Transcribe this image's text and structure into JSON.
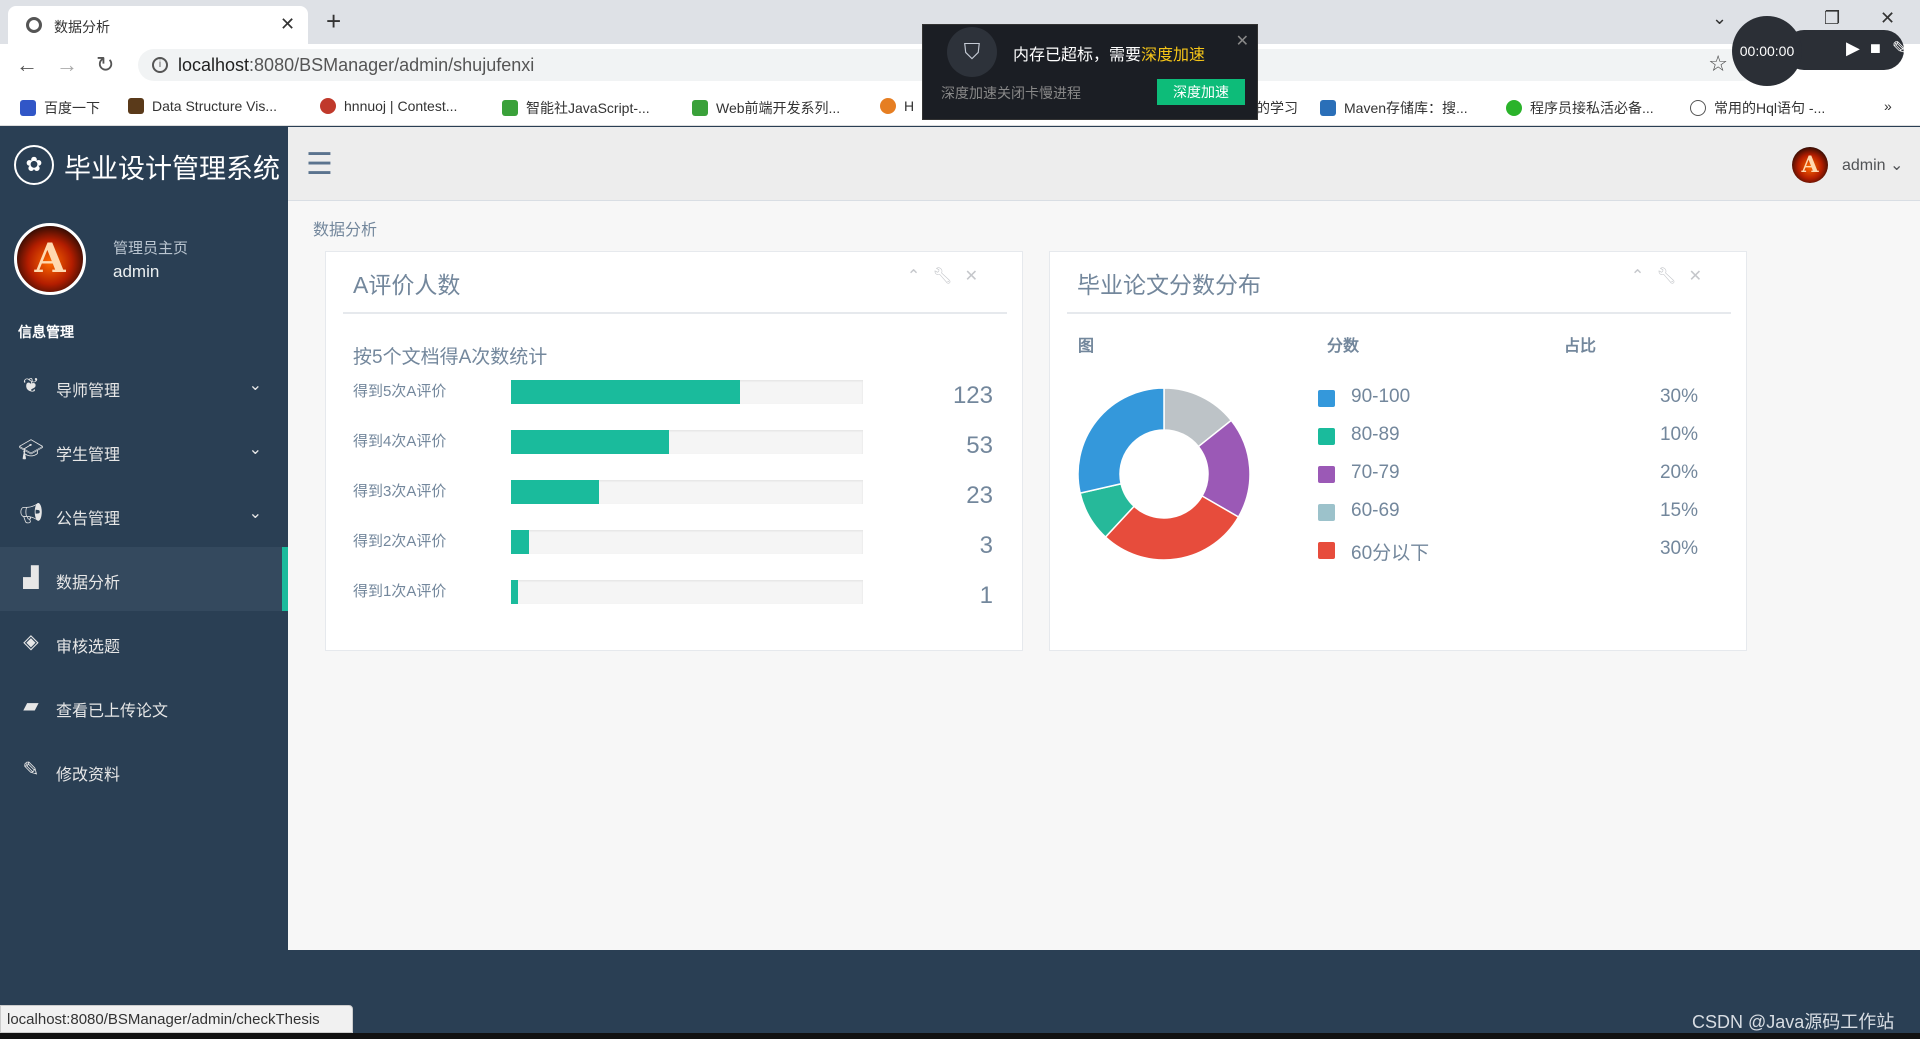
{
  "browser": {
    "tab_title": "数据分析",
    "url_host": "localhost",
    "url_rest": ":8080/BSManager/admin/shujufenxi",
    "bookmarks": [
      "百度一下",
      "Data Structure Vis...",
      "hnnuoj | Contest...",
      "智能社JavaScript-...",
      "Web前端开发系列...",
      "H",
      "的学习",
      "Maven存储库：搜...",
      "程序员接私活必备...",
      "常用的Hql语句 -..."
    ],
    "more": "»",
    "status_url": "localhost:8080/BSManager/admin/checkThesis"
  },
  "popup": {
    "line1_a": "内存已超标，需要",
    "line1_b": "深度加速",
    "line2": "深度加速关闭卡慢进程",
    "button": "深度加速"
  },
  "recorder": {
    "time": "00:00:00"
  },
  "sidebar": {
    "brand": "毕业设计管理系统",
    "welcome": "管理员主页",
    "username": "admin",
    "avatar_letter": "A",
    "section": "信息管理",
    "items": [
      {
        "label": "导师管理",
        "icon": "leaf-icon",
        "chevron": true
      },
      {
        "label": "学生管理",
        "icon": "graduation-cap-icon",
        "chevron": true
      },
      {
        "label": "公告管理",
        "icon": "bullhorn-icon",
        "chevron": true
      },
      {
        "label": "数据分析",
        "icon": "bar-chart-icon",
        "chevron": false,
        "active": true
      },
      {
        "label": "审核选题",
        "icon": "tags-icon",
        "chevron": false
      },
      {
        "label": "查看已上传论文",
        "icon": "folder-open-icon",
        "chevron": false
      },
      {
        "label": "修改资料",
        "icon": "edit-icon",
        "chevron": false
      }
    ]
  },
  "topnav": {
    "user": "admin"
  },
  "breadcrumb": "数据分析",
  "panels": {
    "left": {
      "title": "A评价人数"
    },
    "right": {
      "title": "毕业论文分数分布"
    }
  },
  "watermark": "CSDN @Java源码工作站",
  "chart_data": [
    {
      "type": "bar",
      "title": "按5个文档得A次数统计",
      "categories": [
        "得到5次A评价",
        "得到4次A评价",
        "得到3次A评价",
        "得到2次A评价",
        "得到1次A评价"
      ],
      "values": [
        123,
        53,
        23,
        3,
        1
      ],
      "fill_percent": [
        65,
        45,
        25,
        5,
        2
      ],
      "color": "#1abb9c"
    },
    {
      "type": "pie",
      "headers": [
        "图",
        "分数",
        "占比"
      ],
      "categories": [
        "90-100",
        "80-89",
        "70-79",
        "60-69",
        "60分以下"
      ],
      "values": [
        30,
        10,
        20,
        15,
        30
      ],
      "value_labels": [
        "30%",
        "10%",
        "20%",
        "15%",
        "30%"
      ],
      "legend_colors": [
        "#3498db",
        "#1abb9c",
        "#9b59b6",
        "#9cc2cb",
        "#e74c3c"
      ],
      "ring_order": [
        "60-69",
        "70-79",
        "60分以下",
        "80-89",
        "90-100"
      ],
      "ring_colors": [
        "#bdc3c7",
        "#9b59b6",
        "#e74c3c",
        "#26b99a",
        "#3498db"
      ]
    }
  ]
}
